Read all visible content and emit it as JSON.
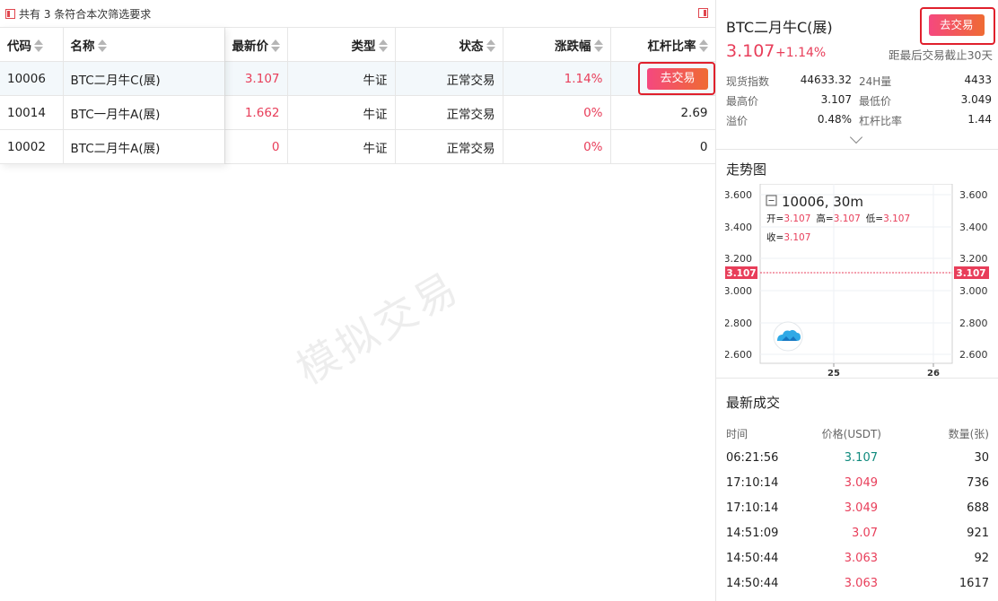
{
  "filter": {
    "text": "共有 3 条符合本次筛选要求"
  },
  "table": {
    "headers": [
      "代码",
      "名称",
      "最新价",
      "类型",
      "状态",
      "涨跌幅",
      "杠杆比率"
    ],
    "rows": [
      {
        "code": "10006",
        "name": "BTC二月牛C(展)",
        "price": "3.107",
        "type": "牛证",
        "status": "正常交易",
        "change": "1.14%",
        "leverage": "",
        "action": "去交易"
      },
      {
        "code": "10014",
        "name": "BTC一月牛A(展)",
        "price": "1.662",
        "type": "牛证",
        "status": "正常交易",
        "change": "0%",
        "leverage": "2.69"
      },
      {
        "code": "10002",
        "name": "BTC二月牛A(展)",
        "price": "0",
        "type": "牛证",
        "status": "正常交易",
        "change": "0%",
        "leverage": "0"
      }
    ]
  },
  "watermark": "模拟交易",
  "detail": {
    "name": "BTC二月牛C(展)",
    "price": "3.107",
    "change": "+1.14%",
    "expire": "距最后交易截止30天",
    "trade_button": "去交易",
    "stats": [
      {
        "l1": "现货指数",
        "v1": "44633.32",
        "l2": "24H量",
        "v2": "4433"
      },
      {
        "l1": "最高价",
        "v1": "3.107",
        "l2": "最低价",
        "v2": "3.049"
      },
      {
        "l1": "溢价",
        "v1": "0.48%",
        "l2": "杠杆比率",
        "v2": "1.44"
      }
    ]
  },
  "trend": {
    "title": "走势图",
    "symbol": "10006, 30m",
    "ohlc": {
      "open_label": "开=",
      "open": "3.107",
      "high_label": "高=",
      "high": "3.107",
      "low_label": "低=",
      "low": "3.107",
      "close_label": "收=",
      "close": "3.107"
    },
    "current_price": "3.107",
    "y_ticks": [
      "3.600",
      "3.400",
      "3.200",
      "3.000",
      "2.800",
      "2.600"
    ],
    "x_ticks": [
      "25",
      "26"
    ]
  },
  "latest_trades": {
    "title": "最新成交",
    "headers": {
      "time": "时间",
      "price": "价格(USDT)",
      "qty": "数量(张)"
    },
    "rows": [
      {
        "time": "06:21:56",
        "price": "3.107",
        "qty": "30",
        "color": "green"
      },
      {
        "time": "17:10:14",
        "price": "3.049",
        "qty": "736",
        "color": "red"
      },
      {
        "time": "17:10:14",
        "price": "3.049",
        "qty": "688",
        "color": "red"
      },
      {
        "time": "14:51:09",
        "price": "3.07",
        "qty": "921",
        "color": "red"
      },
      {
        "time": "14:50:44",
        "price": "3.063",
        "qty": "92",
        "color": "red"
      },
      {
        "time": "14:50:44",
        "price": "3.063",
        "qty": "1617",
        "color": "red"
      }
    ]
  },
  "colors": {
    "up": "#e83e5a",
    "down": "#0f8a7d",
    "highlight": "#e0202c"
  }
}
